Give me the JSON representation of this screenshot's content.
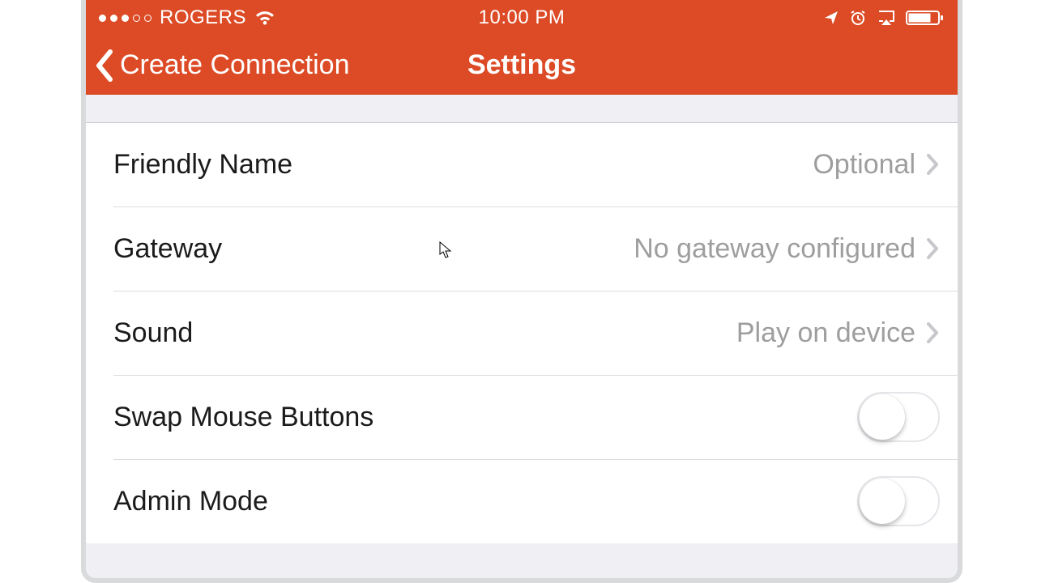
{
  "statusbar": {
    "carrier": "ROGERS",
    "time": "10:00 PM"
  },
  "navbar": {
    "back_label": "Create Connection",
    "title": "Settings"
  },
  "rows": {
    "friendly_name": {
      "label": "Friendly Name",
      "value": "Optional"
    },
    "gateway": {
      "label": "Gateway",
      "value": "No gateway configured"
    },
    "sound": {
      "label": "Sound",
      "value": "Play on device"
    },
    "swap_mouse": {
      "label": "Swap Mouse Buttons",
      "on": false
    },
    "admin_mode": {
      "label": "Admin Mode",
      "on": false
    }
  }
}
